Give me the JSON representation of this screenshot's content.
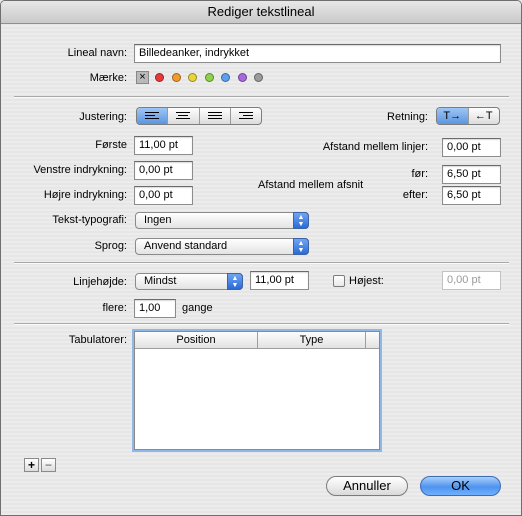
{
  "window": {
    "title": "Rediger tekstlineal"
  },
  "name": {
    "label": "Lineal navn:",
    "value": "Billedeanker, indrykket"
  },
  "mark": {
    "label": "Mærke:",
    "none_icon": "close-icon",
    "colors": [
      "#e53b3b",
      "#f39a2b",
      "#e9d53a",
      "#8fd14b",
      "#5aa0ef",
      "#a969dd",
      "#9b9b9b"
    ]
  },
  "alignment": {
    "label": "Justering:",
    "options": [
      "align-left-icon",
      "align-center-icon",
      "align-justify-icon",
      "align-right-icon"
    ],
    "selected": 0
  },
  "direction": {
    "label": "Retning:",
    "ltr": "T→",
    "rtl": "←T",
    "selected": "ltr"
  },
  "first": {
    "label": "Første",
    "value": "11,00 pt"
  },
  "left_indent": {
    "label": "Venstre indrykning:",
    "value": "0,00 pt"
  },
  "right_indent": {
    "label": "Højre indrykning:",
    "value": "0,00 pt"
  },
  "line_spacing": {
    "label": "Afstand mellem linjer:",
    "value": "0,00 pt"
  },
  "para_spacing": {
    "label": "Afstand mellem afsnit",
    "before_label": "før:",
    "before_value": "6,50 pt",
    "after_label": "efter:",
    "after_value": "6,50 pt"
  },
  "text_style": {
    "label": "Tekst-typografi:",
    "value": "Ingen"
  },
  "language": {
    "label": "Sprog:",
    "value": "Anvend standard"
  },
  "line_height": {
    "label": "Linjehøjde:",
    "mode": "Mindst",
    "value": "11,00 pt",
    "max_label": "Højest:",
    "max_value": "0,00 pt",
    "multiple_label": "flere:",
    "multiple_value": "1,00",
    "multiple_unit": "gange"
  },
  "tabs": {
    "label": "Tabulatorer:",
    "columns": [
      "Position",
      "Type"
    ],
    "rows": []
  },
  "buttons": {
    "add": "+",
    "remove": "−",
    "cancel": "Annuller",
    "ok": "OK"
  }
}
